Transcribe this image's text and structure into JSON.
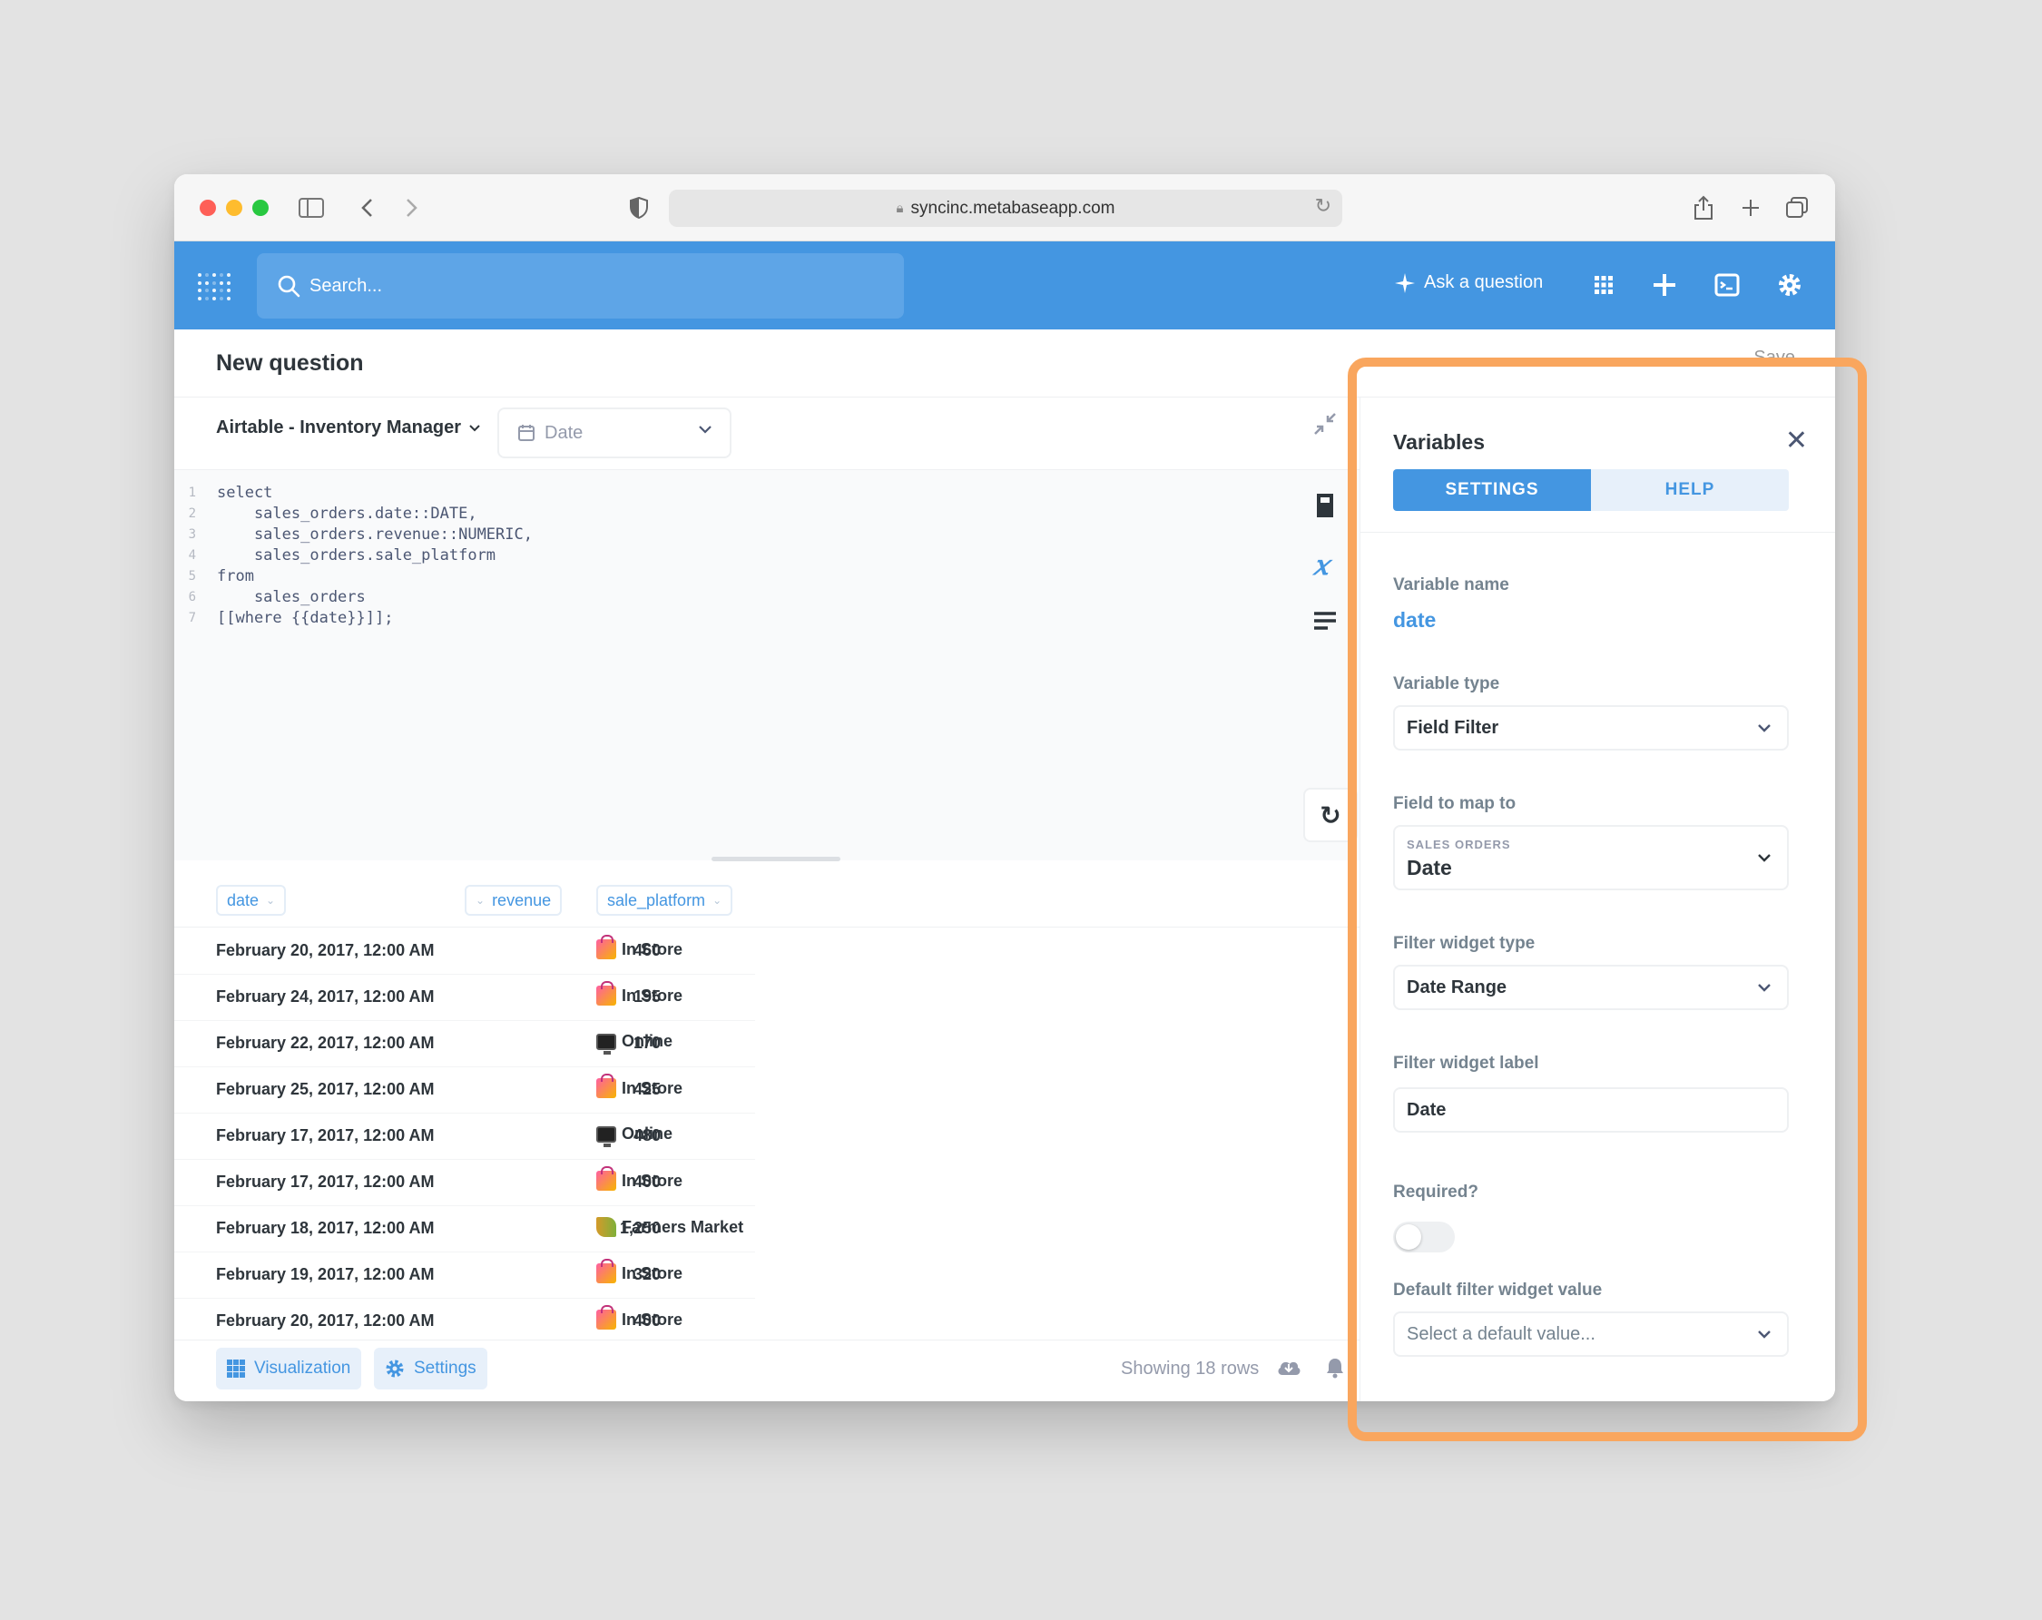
{
  "browser": {
    "url": "syncinc.metabaseapp.com"
  },
  "nav": {
    "search_placeholder": "Search...",
    "ask_question": "Ask a question"
  },
  "header": {
    "title": "New question",
    "save_label_partial": "Save"
  },
  "editor": {
    "database": "Airtable - Inventory Manager",
    "date_chip": "Date",
    "code_lines": [
      {
        "n": "1",
        "text": "select"
      },
      {
        "n": "2",
        "text": "    sales_orders.date::DATE,"
      },
      {
        "n": "3",
        "text": "    sales_orders.revenue::NUMERIC,"
      },
      {
        "n": "4",
        "text": "    sales_orders.sale_platform"
      },
      {
        "n": "5",
        "text": "from"
      },
      {
        "n": "6",
        "text": "    sales_orders"
      },
      {
        "n": "7",
        "text": "[[where {{date}}]];"
      }
    ]
  },
  "results": {
    "columns": [
      "date",
      "revenue",
      "sale_platform"
    ],
    "rows": [
      {
        "date": "February 20, 2017, 12:00 AM",
        "revenue": "460",
        "platform": "In Store",
        "icon": "shopping-bags-icon"
      },
      {
        "date": "February 24, 2017, 12:00 AM",
        "revenue": "195",
        "platform": "In Store",
        "icon": "shopping-bags-icon"
      },
      {
        "date": "February 22, 2017, 12:00 AM",
        "revenue": "170",
        "platform": "Online",
        "icon": "computer-icon"
      },
      {
        "date": "February 25, 2017, 12:00 AM",
        "revenue": "425",
        "platform": "In Store",
        "icon": "shopping-bags-icon"
      },
      {
        "date": "February 17, 2017, 12:00 AM",
        "revenue": "480",
        "platform": "Online",
        "icon": "computer-icon"
      },
      {
        "date": "February 17, 2017, 12:00 AM",
        "revenue": "400",
        "platform": "In Store",
        "icon": "shopping-bags-icon"
      },
      {
        "date": "February 18, 2017, 12:00 AM",
        "revenue": "1,250",
        "platform": "Farmers Market",
        "icon": "rice-icon"
      },
      {
        "date": "February 19, 2017, 12:00 AM",
        "revenue": "320",
        "platform": "In Store",
        "icon": "shopping-bags-icon"
      },
      {
        "date": "February 20, 2017, 12:00 AM",
        "revenue": "400",
        "platform": "In Store",
        "icon": "shopping-bags-icon"
      }
    ]
  },
  "footer": {
    "visualization": "Visualization",
    "settings": "Settings",
    "row_count": "Showing 18 rows"
  },
  "panel": {
    "title": "Variables",
    "tabs": [
      "SETTINGS",
      "HELP"
    ],
    "variable_name_label": "Variable name",
    "variable_name": "date",
    "variable_type_label": "Variable type",
    "variable_type": "Field Filter",
    "field_map_label": "Field to map to",
    "field_map_table": "SALES ORDERS",
    "field_map_field": "Date",
    "widget_type_label": "Filter widget type",
    "widget_type": "Date Range",
    "widget_label_label": "Filter widget label",
    "widget_label": "Date",
    "required_label": "Required?",
    "required": false,
    "default_label": "Default filter widget value",
    "default_placeholder": "Select a default value..."
  },
  "colors": {
    "brand": "#4496e1",
    "highlight": "#f9a65e"
  }
}
